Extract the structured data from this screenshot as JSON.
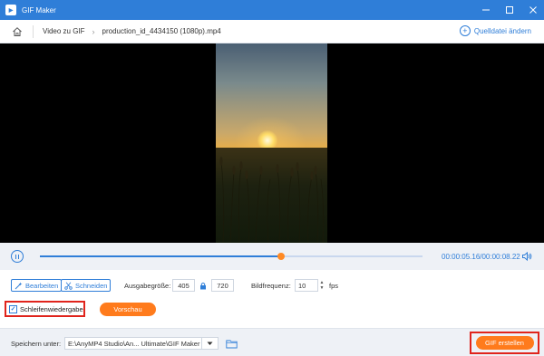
{
  "window": {
    "title": "GIF Maker",
    "minimize_icon": "minimize-icon",
    "maximize_icon": "maximize-icon",
    "close_icon": "close-icon"
  },
  "nav": {
    "home_icon": "home-icon",
    "breadcrumb_section": "Video zu GIF",
    "file_name": "production_id_4434150 (1080p).mp4",
    "change_source_label": "Quelldatei ändern"
  },
  "playback": {
    "current_time": "00:00:05.16",
    "total_time": "00:00:08.22",
    "time_display": "00:00:05.16/00:00:08.22",
    "progress_fraction": 0.63
  },
  "tools": {
    "edit_label": "Bearbeiten",
    "cut_label": "Schneiden",
    "output_size_label": "Ausgabegröße:",
    "width_value": "405",
    "height_value": "720",
    "framerate_label": "Bildfrequenz:",
    "framerate_value": "10",
    "fps_unit": "fps",
    "loop_label": "Schleifenwiedergabe",
    "loop_checked": true,
    "preview_label": "Vorschau"
  },
  "footer": {
    "save_label": "Speichern unter:",
    "save_path": "E:\\AnyMP4 Studio\\An... Ultimate\\GIF Maker",
    "create_label": "GIF erstellen"
  },
  "colors": {
    "accent": "#2f7ed8",
    "action": "#ff7b1c",
    "highlight": "#e0241c"
  }
}
